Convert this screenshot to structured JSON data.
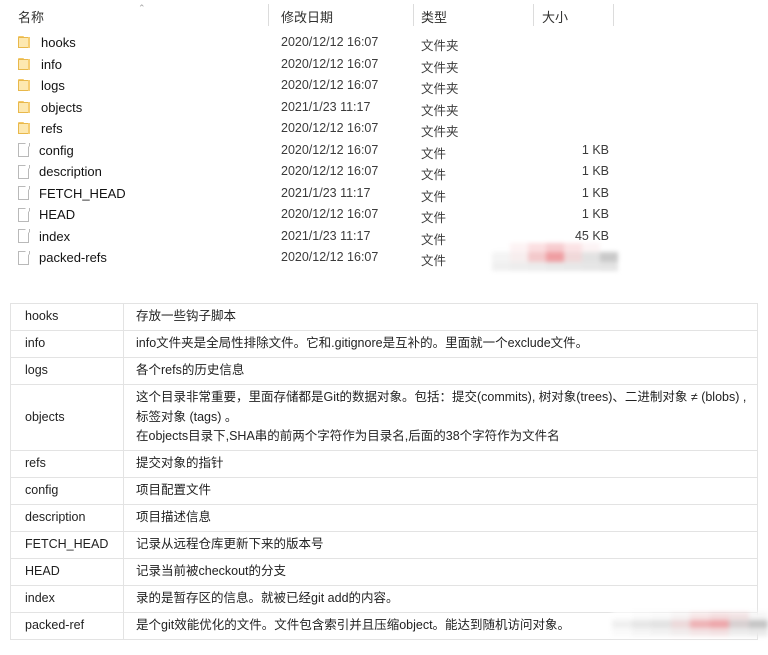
{
  "explorer": {
    "columns": [
      {
        "key": "name",
        "label": "名称"
      },
      {
        "key": "modified",
        "label": "修改日期"
      },
      {
        "key": "type",
        "label": "类型"
      },
      {
        "key": "size",
        "label": "大小"
      }
    ],
    "sort_indicator": "⌃",
    "type_labels": {
      "folder": "文件夹",
      "file": "文件"
    },
    "rows": [
      {
        "icon": "folder-icon",
        "name": "hooks",
        "modified": "2020/12/12 16:07",
        "type": "文件夹",
        "size": ""
      },
      {
        "icon": "folder-icon",
        "name": "info",
        "modified": "2020/12/12 16:07",
        "type": "文件夹",
        "size": ""
      },
      {
        "icon": "folder-icon",
        "name": "logs",
        "modified": "2020/12/12 16:07",
        "type": "文件夹",
        "size": ""
      },
      {
        "icon": "folder-icon",
        "name": "objects",
        "modified": "2021/1/23 11:17",
        "type": "文件夹",
        "size": ""
      },
      {
        "icon": "folder-icon",
        "name": "refs",
        "modified": "2020/12/12 16:07",
        "type": "文件夹",
        "size": ""
      },
      {
        "icon": "file-icon",
        "name": "config",
        "modified": "2020/12/12 16:07",
        "type": "文件",
        "size": "1 KB"
      },
      {
        "icon": "file-icon",
        "name": "description",
        "modified": "2020/12/12 16:07",
        "type": "文件",
        "size": "1 KB"
      },
      {
        "icon": "file-icon",
        "name": "FETCH_HEAD",
        "modified": "2021/1/23 11:17",
        "type": "文件",
        "size": "1 KB"
      },
      {
        "icon": "file-icon",
        "name": "HEAD",
        "modified": "2020/12/12 16:07",
        "type": "文件",
        "size": "1 KB"
      },
      {
        "icon": "file-icon",
        "name": "index",
        "modified": "2021/1/23 11:17",
        "type": "文件",
        "size": "45 KB"
      },
      {
        "icon": "file-icon",
        "name": "packed-refs",
        "modified": "2020/12/12 16:07",
        "type": "文件",
        "size": ""
      }
    ]
  },
  "description_table": {
    "rows": [
      {
        "key": "hooks",
        "lines": [
          "存放一些钩子脚本"
        ]
      },
      {
        "key": "info",
        "lines": [
          "info文件夹是全局性排除文件。它和.gitignore是互补的。里面就一个exclude文件。"
        ]
      },
      {
        "key": "logs",
        "lines": [
          " 各个refs的历史信息"
        ]
      },
      {
        "key": "objects",
        "lines": [
          "这个目录非常重要，里面存储都是Git的数据对象。包括：提交(commits), 树对象(trees)、二进制对象 ≠ (blobs) ,标签对象 (tags) 。",
          "在objects目录下,SHA串的前两个字符作为目录名,后面的38个字符作为文件名"
        ]
      },
      {
        "key": "refs",
        "lines": [
          " 提交对象的指针"
        ]
      },
      {
        "key": "config",
        "lines": [
          "项目配置文件"
        ]
      },
      {
        "key": "description",
        "lines": [
          "项目描述信息"
        ]
      },
      {
        "key": "FETCH_HEAD",
        "lines": [
          "记录从远程仓库更新下来的版本号"
        ]
      },
      {
        "key": "HEAD",
        "lines": [
          "记录当前被checkout的分支"
        ]
      },
      {
        "key": "index",
        "lines": [
          "录的是暂存区的信息。就被已经git add的内容。"
        ]
      },
      {
        "key": "packed-ref",
        "lines": [
          "是个git效能优化的文件。文件包含索引并且压缩object。能达到随机访问对象。"
        ]
      }
    ]
  },
  "redactions": {
    "top": {
      "name": "redaction-blur-top",
      "cells": [
        "#ffffff",
        "#fdf3f4",
        "#fbdfe1",
        "#f7cccf",
        "#fbe3e5",
        "#fdf4f5",
        "#ffffff",
        "#f4f4f4",
        "#f7eeee",
        "#f3c9cb",
        "#ef9ea2",
        "#f0d8d9",
        "#e2e2e2",
        "#c9c9c9",
        "#f0f0f0",
        "#ededed",
        "#ececec",
        "#e9e9e9",
        "#e8e8e8",
        "#e6e6e6",
        "#e4e4e4"
      ]
    },
    "bottom": {
      "name": "redaction-blur-bottom",
      "cells": [
        "#ffffff",
        "#fcfcfc",
        "#fafafa",
        "#f7f4f4",
        "#f7e7e8",
        "#f4dedf",
        "#f2e3e4",
        "#f6f6f6",
        "#efefef",
        "#e6e6e6",
        "#e2e2e2",
        "#ecd9da",
        "#eeb1b4",
        "#eda5a9",
        "#d7cfd0",
        "#c4c4c4",
        "#fafafa",
        "#f5f5f5",
        "#f2f2f2",
        "#f1ecec",
        "#f3e4e5",
        "#f2e0e1",
        "#ececec",
        "#e9e9e9"
      ]
    }
  },
  "colors": {
    "folder": "#f4c96a",
    "folder_fill": "#fde8b0",
    "file_border": "#b9b9b9",
    "table_border": "#e3e3e3",
    "header_sep": "#dcdcdc",
    "text": "#1a1a1a"
  }
}
